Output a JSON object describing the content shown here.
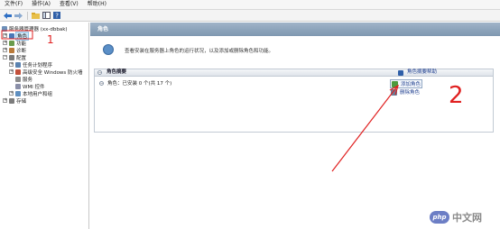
{
  "menubar": {
    "items": [
      "文件(F)",
      "操作(A)",
      "查看(V)",
      "帮助(H)"
    ]
  },
  "toolbar": {
    "buttons": [
      "back-icon",
      "forward-icon",
      "folder-up-icon",
      "console-tree-icon",
      "help-icon"
    ]
  },
  "tree": {
    "root": "服务器管理器 (xx-dbbak)",
    "items": [
      {
        "label": "角色",
        "selected": true,
        "icon": "roles-icon"
      },
      {
        "label": "功能",
        "icon": "features-icon"
      },
      {
        "label": "诊断",
        "icon": "diagnostics-icon"
      },
      {
        "label": "配置",
        "icon": "configuration-icon"
      },
      {
        "label": "任务计划程序",
        "icon": "task-scheduler-icon"
      },
      {
        "label": "高级安全 Windows 防火墙",
        "icon": "firewall-icon"
      },
      {
        "label": "服务",
        "icon": "services-icon"
      },
      {
        "label": "WMI 控件",
        "icon": "wmi-icon"
      },
      {
        "label": "本地用户和组",
        "icon": "users-groups-icon"
      },
      {
        "label": "存储",
        "icon": "storage-icon"
      }
    ]
  },
  "main": {
    "header": "角色",
    "intro": "查看安装在服务器上角色的运行状况，以及添加或删除角色和功能。",
    "summary": {
      "title": "角色摘要",
      "help_link": "角色摘要帮助",
      "roles_status": "角色：已安装 0 个(共 17 个)",
      "actions": {
        "add": "添加角色",
        "remove": "删除角色"
      }
    }
  },
  "annotations": {
    "marker_1": "1",
    "marker_2": "2",
    "color": "#e02020"
  },
  "watermark": {
    "logo": "php",
    "text": "中文网"
  }
}
